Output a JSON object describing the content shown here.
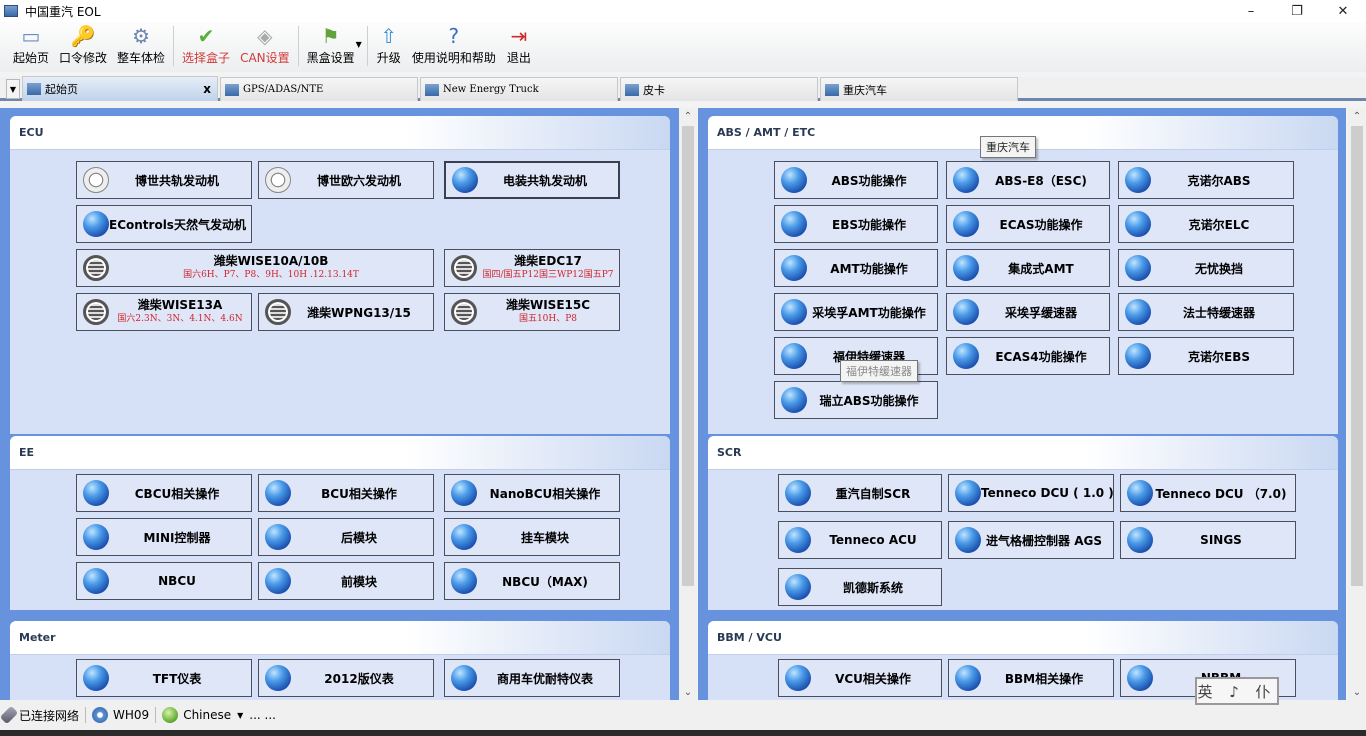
{
  "window": {
    "title": "中国重汽 EOL",
    "min": "–",
    "max": "❐",
    "close": "✕"
  },
  "toolbar": [
    {
      "label": "起始页",
      "icon": "home-window-icon",
      "glyph": "▭",
      "color": "#6b8cc0",
      "red": false
    },
    {
      "label": "口令修改",
      "icon": "key-icon",
      "glyph": "🔑",
      "color": "#c9a23a",
      "red": false
    },
    {
      "label": "整车体检",
      "icon": "gear-check-icon",
      "glyph": "⚙",
      "color": "#6d86b0",
      "red": false
    },
    {
      "label": "选择盒子",
      "icon": "checkmark-icon",
      "glyph": "✔",
      "color": "#5cae3a",
      "red": true
    },
    {
      "label": "CAN设置",
      "icon": "device-box-icon",
      "glyph": "◈",
      "color": "#aaa",
      "red": true
    },
    {
      "label": "黑盒设置",
      "icon": "green-flag-icon",
      "glyph": "⚑",
      "color": "#5fa33a",
      "red": false
    },
    {
      "label": "升级",
      "icon": "upgrade-arrow-icon",
      "glyph": "⇧",
      "color": "#3a8fd8",
      "red": false
    },
    {
      "label": "使用说明和帮助",
      "icon": "help-icon",
      "glyph": "?",
      "color": "#3a6fc0",
      "red": false
    },
    {
      "label": "退出",
      "icon": "exit-door-icon",
      "glyph": "⇥",
      "color": "#d02a2a",
      "red": false
    }
  ],
  "tabs": [
    {
      "label": "起始页",
      "close": "x"
    },
    {
      "label": "GPS/ADAS/NTE"
    },
    {
      "label": "New Energy Truck"
    },
    {
      "label": "皮卡"
    },
    {
      "label": "重庆汽车"
    }
  ],
  "groups": {
    "ecu": {
      "title": "ECU",
      "buttons": [
        {
          "label": "博世共轨发动机",
          "icon": "bosch"
        },
        {
          "label": "博世欧六发动机",
          "icon": "bosch"
        },
        {
          "label": "电装共轨发动机",
          "icon": "globe"
        },
        {
          "label": "EControls天然气发动机",
          "icon": "globe"
        },
        {
          "label": "潍柴WISE10A/10B",
          "sub": "国六6H、P7、P8、9H、10H .12.13.14T",
          "icon": "weichai"
        },
        {
          "label": "潍柴EDC17",
          "sub": "国四/国五P12国三WP12国五P7",
          "icon": "weichai"
        },
        {
          "label": "潍柴WISE13A",
          "sub": "国六2.3N、3N、4.1N、4.6N",
          "icon": "weichai"
        },
        {
          "label": "潍柴WPNG13/15",
          "icon": "weichai"
        },
        {
          "label": "潍柴WISE15C",
          "sub": "国五10H、P8",
          "icon": "weichai"
        }
      ]
    },
    "ee": {
      "title": "EE",
      "buttons": [
        {
          "label": "CBCU相关操作"
        },
        {
          "label": "BCU相关操作"
        },
        {
          "label": "NanoBCU相关操作"
        },
        {
          "label": "MINI控制器"
        },
        {
          "label": "后模块"
        },
        {
          "label": "挂车模块"
        },
        {
          "label": "NBCU"
        },
        {
          "label": "前模块"
        },
        {
          "label": "NBCU（MAX)"
        }
      ]
    },
    "meter": {
      "title": "Meter",
      "buttons": [
        {
          "label": "TFT仪表"
        },
        {
          "label": "2012版仪表"
        },
        {
          "label": "商用车优耐特仪表"
        }
      ]
    },
    "abs": {
      "title": "ABS / AMT / ETC",
      "buttons": [
        {
          "label": "ABS功能操作"
        },
        {
          "label": "ABS-E8（ESC)"
        },
        {
          "label": "克诺尔ABS"
        },
        {
          "label": "EBS功能操作"
        },
        {
          "label": "ECAS功能操作"
        },
        {
          "label": "克诺尔ELC"
        },
        {
          "label": "AMT功能操作"
        },
        {
          "label": "集成式AMT"
        },
        {
          "label": "无忧换挡"
        },
        {
          "label": "采埃孚AMT功能操作"
        },
        {
          "label": "采埃孚缓速器"
        },
        {
          "label": "法士特缓速器"
        },
        {
          "label": "福伊特缓速器"
        },
        {
          "label": "ECAS4功能操作"
        },
        {
          "label": "克诺尔EBS"
        },
        {
          "label": "瑞立ABS功能操作"
        }
      ],
      "tooltips": [
        "重庆汽车",
        "福伊特缓速器"
      ]
    },
    "scr": {
      "title": "SCR",
      "buttons": [
        {
          "label": "重汽自制SCR"
        },
        {
          "label": "Tenneco DCU ( 1.0 )"
        },
        {
          "label": "Tenneco DCU （7.0)"
        },
        {
          "label": "Tenneco ACU"
        },
        {
          "label": "进气格栅控制器 AGS"
        },
        {
          "label": "SINGS"
        },
        {
          "label": "凯德斯系统"
        }
      ]
    },
    "bbm": {
      "title": "BBM / VCU",
      "buttons": [
        {
          "label": "VCU相关操作"
        },
        {
          "label": "BBM相关操作"
        },
        {
          "label": "NBBM"
        }
      ]
    }
  },
  "status": {
    "network": "已连接网络",
    "device": "WH09",
    "language": "Chinese",
    "more": "... ..."
  },
  "ime": "英 ♪ 仆"
}
